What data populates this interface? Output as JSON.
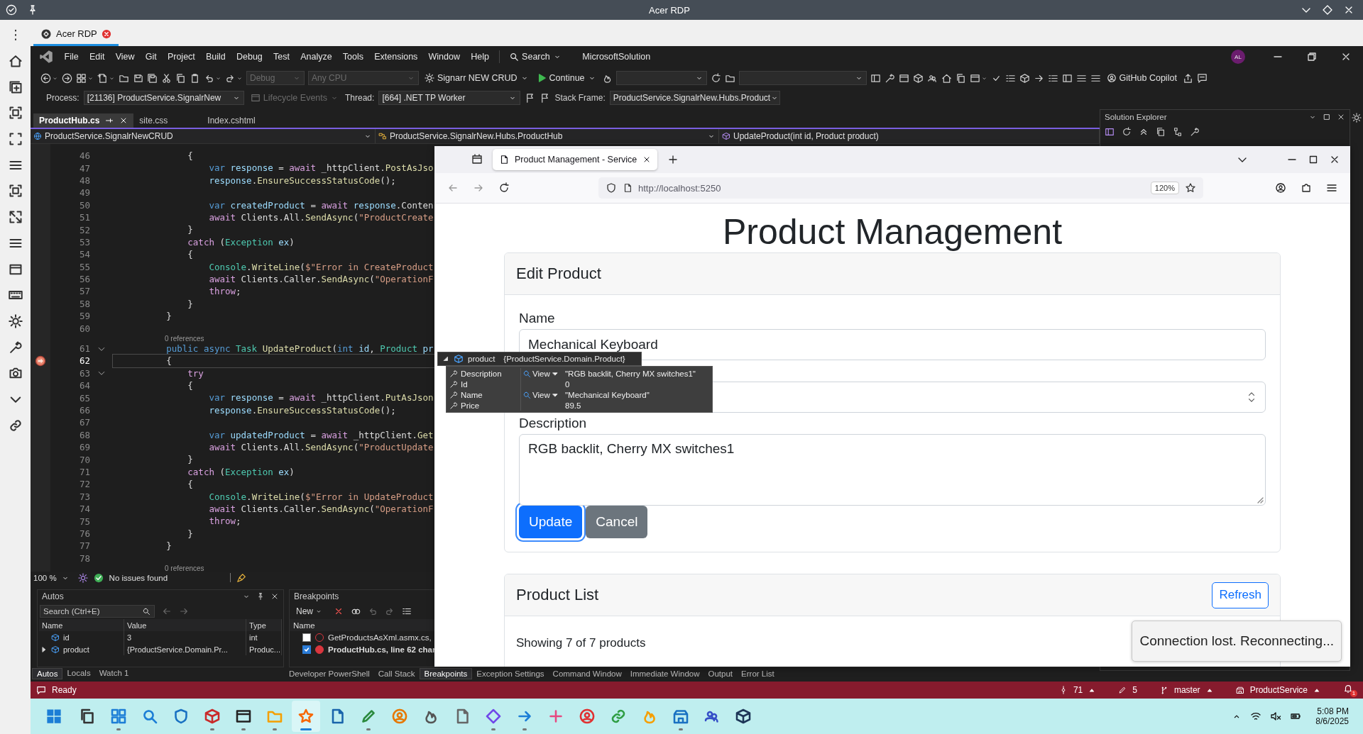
{
  "rdp": {
    "title": "Acer RDP",
    "tab": {
      "label": "Acer RDP"
    }
  },
  "vs": {
    "menu": [
      "File",
      "Edit",
      "View",
      "Git",
      "Project",
      "Build",
      "Debug",
      "Test",
      "Analyze",
      "Tools",
      "Extensions",
      "Window",
      "Help"
    ],
    "search": "Search",
    "solution": "MicrosoftSolution",
    "avatar": "AL",
    "toolbar": {
      "config": "Debug",
      "platform": "Any CPU",
      "startup": "Signarr NEW CRUD",
      "continue": "Continue",
      "copilot": "GitHub Copilot"
    },
    "debug_bar": {
      "process_label": "Process:",
      "process": "[21136] ProductService.SignalrNew",
      "lifecycle": "Lifecycle Events",
      "thread_label": "Thread:",
      "thread": "[664] .NET TP Worker",
      "frame_label": "Stack Frame:",
      "frame": "ProductService.SignalrNew.Hubs.Product"
    },
    "doc_tabs": [
      {
        "label": "ProductHub.cs",
        "selected": true,
        "pinned": true
      },
      {
        "label": "site.css",
        "selected": false,
        "pinned": false
      },
      {
        "label": "Index.cshtml",
        "selected": false,
        "pinned": false
      }
    ],
    "nav": [
      "ProductService.SignalrNewCRUD",
      "ProductService.SignalrNew.Hubs.ProductHub",
      "UpdateProduct(int id, Product product)"
    ],
    "editor": {
      "lines": [
        {
          "kind": "code",
          "num": "46",
          "fold": false,
          "current": false,
          "tokens": [
            {
              "text": "            {",
              "kind": "p"
            }
          ]
        },
        {
          "kind": "code",
          "num": "47",
          "fold": false,
          "current": false,
          "tokens": [
            {
              "text": "                var",
              "kind": "kw"
            },
            {
              "text": " response",
              "kind": "v"
            },
            {
              "text": " = ",
              "kind": "p"
            },
            {
              "text": "await",
              "kind": "ctl"
            },
            {
              "text": " _httpClient.",
              "kind": "p"
            },
            {
              "text": "PostAsJso",
              "kind": "m"
            }
          ]
        },
        {
          "kind": "code",
          "num": "48",
          "fold": false,
          "current": false,
          "tokens": [
            {
              "text": "                response",
              "kind": "v"
            },
            {
              "text": ".",
              "kind": "p"
            },
            {
              "text": "EnsureSuccessStatusCode",
              "kind": "m"
            },
            {
              "text": "();",
              "kind": "p"
            }
          ]
        },
        {
          "kind": "code",
          "num": "49",
          "fold": false,
          "current": false
        },
        {
          "kind": "code",
          "num": "50",
          "fold": false,
          "current": false,
          "tokens": [
            {
              "text": "                var",
              "kind": "kw"
            },
            {
              "text": " createdProduct",
              "kind": "v"
            },
            {
              "text": " = ",
              "kind": "p"
            },
            {
              "text": "await",
              "kind": "ctl"
            },
            {
              "text": " response",
              "kind": "v"
            },
            {
              "text": ".Conten",
              "kind": "p"
            }
          ]
        },
        {
          "kind": "code",
          "num": "51",
          "fold": false,
          "current": false,
          "tokens": [
            {
              "text": "                await",
              "kind": "ctl"
            },
            {
              "text": " Clients.All.",
              "kind": "p"
            },
            {
              "text": "SendAsync",
              "kind": "m"
            },
            {
              "text": "(",
              "kind": "p"
            },
            {
              "text": "\"ProductCreate",
              "kind": "s"
            }
          ]
        },
        {
          "kind": "code",
          "num": "52",
          "fold": false,
          "current": false,
          "tokens": [
            {
              "text": "            }",
              "kind": "p"
            }
          ]
        },
        {
          "kind": "code",
          "num": "53",
          "fold": false,
          "current": false,
          "tokens": [
            {
              "text": "            catch",
              "kind": "ctl"
            },
            {
              "text": " (",
              "kind": "p"
            },
            {
              "text": "Exception",
              "kind": "t"
            },
            {
              "text": " ex",
              "kind": "v"
            },
            {
              "text": ")",
              "kind": "p"
            }
          ]
        },
        {
          "kind": "code",
          "num": "54",
          "fold": false,
          "current": false,
          "tokens": [
            {
              "text": "            {",
              "kind": "p"
            }
          ]
        },
        {
          "kind": "code",
          "num": "55",
          "fold": false,
          "current": false,
          "tokens": [
            {
              "text": "                Console",
              "kind": "t"
            },
            {
              "text": ".",
              "kind": "p"
            },
            {
              "text": "WriteLine",
              "kind": "m"
            },
            {
              "text": "(",
              "kind": "p"
            },
            {
              "text": "$\"Error in CreateProduct",
              "kind": "s"
            }
          ]
        },
        {
          "kind": "code",
          "num": "56",
          "fold": false,
          "current": false,
          "tokens": [
            {
              "text": "                await",
              "kind": "ctl"
            },
            {
              "text": " Clients.Caller.",
              "kind": "p"
            },
            {
              "text": "SendAsync",
              "kind": "m"
            },
            {
              "text": "(",
              "kind": "p"
            },
            {
              "text": "\"OperationF",
              "kind": "s"
            }
          ]
        },
        {
          "kind": "code",
          "num": "57",
          "fold": false,
          "current": false,
          "tokens": [
            {
              "text": "                throw",
              "kind": "ctl"
            },
            {
              "text": ";",
              "kind": "p"
            }
          ]
        },
        {
          "kind": "code",
          "num": "58",
          "fold": false,
          "current": false,
          "tokens": [
            {
              "text": "            }",
              "kind": "p"
            }
          ]
        },
        {
          "kind": "code",
          "num": "59",
          "fold": false,
          "current": false,
          "tokens": [
            {
              "text": "        }",
              "kind": "p"
            }
          ]
        },
        {
          "kind": "code",
          "num": "60",
          "fold": false,
          "current": false
        },
        {
          "kind": "lens",
          "text": "0 references"
        },
        {
          "kind": "code",
          "num": "61",
          "fold": true,
          "current": false,
          "tokens": [
            {
              "text": "        public",
              "kind": "kw"
            },
            {
              "text": " async",
              "kind": "kw"
            },
            {
              "text": " Task",
              "kind": "t"
            },
            {
              "text": " UpdateProduct",
              "kind": "m"
            },
            {
              "text": "(",
              "kind": "p"
            },
            {
              "text": "int",
              "kind": "kw"
            },
            {
              "text": " id",
              "kind": "v"
            },
            {
              "text": ", ",
              "kind": "p"
            },
            {
              "text": "Product",
              "kind": "t"
            },
            {
              "text": " pr",
              "kind": "v"
            }
          ]
        },
        {
          "kind": "code",
          "num": "62",
          "fold": false,
          "current": true,
          "tokens": [
            {
              "text": "        {",
              "kind": "p"
            }
          ]
        },
        {
          "kind": "code",
          "num": "63",
          "fold": true,
          "current": false,
          "tokens": [
            {
              "text": "            try",
              "kind": "ctl"
            }
          ]
        },
        {
          "kind": "code",
          "num": "64",
          "fold": false,
          "current": false,
          "tokens": [
            {
              "text": "            {",
              "kind": "p"
            }
          ]
        },
        {
          "kind": "code",
          "num": "65",
          "fold": false,
          "current": false,
          "tokens": [
            {
              "text": "                var",
              "kind": "kw"
            },
            {
              "text": " response",
              "kind": "v"
            },
            {
              "text": " = ",
              "kind": "p"
            },
            {
              "text": "await",
              "kind": "ctl"
            },
            {
              "text": " _httpClient.",
              "kind": "p"
            },
            {
              "text": "PutAsJson",
              "kind": "m"
            }
          ]
        },
        {
          "kind": "code",
          "num": "66",
          "fold": false,
          "current": false,
          "tokens": [
            {
              "text": "                response",
              "kind": "v"
            },
            {
              "text": ".",
              "kind": "p"
            },
            {
              "text": "EnsureSuccessStatusCode",
              "kind": "m"
            },
            {
              "text": "();",
              "kind": "p"
            }
          ]
        },
        {
          "kind": "code",
          "num": "67",
          "fold": false,
          "current": false
        },
        {
          "kind": "code",
          "num": "68",
          "fold": false,
          "current": false,
          "tokens": [
            {
              "text": "                var",
              "kind": "kw"
            },
            {
              "text": " updatedProduct",
              "kind": "v"
            },
            {
              "text": " = ",
              "kind": "p"
            },
            {
              "text": "await",
              "kind": "ctl"
            },
            {
              "text": " _httpClient.",
              "kind": "p"
            },
            {
              "text": "Get",
              "kind": "m"
            }
          ]
        },
        {
          "kind": "code",
          "num": "69",
          "fold": false,
          "current": false,
          "tokens": [
            {
              "text": "                await",
              "kind": "ctl"
            },
            {
              "text": " Clients.All.",
              "kind": "p"
            },
            {
              "text": "SendAsync",
              "kind": "m"
            },
            {
              "text": "(",
              "kind": "p"
            },
            {
              "text": "\"ProductUpdate",
              "kind": "s"
            }
          ]
        },
        {
          "kind": "code",
          "num": "70",
          "fold": false,
          "current": false,
          "tokens": [
            {
              "text": "            }",
              "kind": "p"
            }
          ]
        },
        {
          "kind": "code",
          "num": "71",
          "fold": false,
          "current": false,
          "tokens": [
            {
              "text": "            catch",
              "kind": "ctl"
            },
            {
              "text": " (",
              "kind": "p"
            },
            {
              "text": "Exception",
              "kind": "t"
            },
            {
              "text": " ex",
              "kind": "v"
            },
            {
              "text": ")",
              "kind": "p"
            }
          ]
        },
        {
          "kind": "code",
          "num": "72",
          "fold": false,
          "current": false,
          "tokens": [
            {
              "text": "            {",
              "kind": "p"
            }
          ]
        },
        {
          "kind": "code",
          "num": "73",
          "fold": false,
          "current": false,
          "tokens": [
            {
              "text": "                Console",
              "kind": "t"
            },
            {
              "text": ".",
              "kind": "p"
            },
            {
              "text": "WriteLine",
              "kind": "m"
            },
            {
              "text": "(",
              "kind": "p"
            },
            {
              "text": "$\"Error in UpdateProduct",
              "kind": "s"
            }
          ]
        },
        {
          "kind": "code",
          "num": "74",
          "fold": false,
          "current": false,
          "tokens": [
            {
              "text": "                await",
              "kind": "ctl"
            },
            {
              "text": " Clients.Caller.",
              "kind": "p"
            },
            {
              "text": "SendAsync",
              "kind": "m"
            },
            {
              "text": "(",
              "kind": "p"
            },
            {
              "text": "\"OperationF",
              "kind": "s"
            }
          ]
        },
        {
          "kind": "code",
          "num": "75",
          "fold": false,
          "current": false,
          "tokens": [
            {
              "text": "                throw",
              "kind": "ctl"
            },
            {
              "text": ";",
              "kind": "p"
            }
          ]
        },
        {
          "kind": "code",
          "num": "76",
          "fold": false,
          "current": false,
          "tokens": [
            {
              "text": "            }",
              "kind": "p"
            }
          ]
        },
        {
          "kind": "code",
          "num": "77",
          "fold": false,
          "current": false,
          "tokens": [
            {
              "text": "        }",
              "kind": "p"
            }
          ]
        },
        {
          "kind": "code",
          "num": "78",
          "fold": false,
          "current": false
        },
        {
          "kind": "lens",
          "text": "0 references"
        }
      ],
      "zoom": "100 %",
      "issues": "No issues found"
    },
    "datatip": {
      "title": "product",
      "type": "{ProductService.Domain.Product}",
      "expanded": true,
      "rows": [
        {
          "name": "Description",
          "view": "View",
          "value": "\"RGB backlit, Cherry MX switches1\""
        },
        {
          "name": "Id",
          "value": "0"
        },
        {
          "name": "Name",
          "view": "View",
          "value": "\"Mechanical Keyboard\""
        },
        {
          "name": "Price",
          "value": "89.5"
        }
      ]
    },
    "autos": {
      "title": "Autos",
      "search_placeholder": "Search (Ctrl+E)",
      "columns": [
        "Name",
        "Value",
        "Type"
      ],
      "rows": [
        {
          "name": "id",
          "value": "3",
          "type": "int",
          "expandable": false
        },
        {
          "name": "product",
          "value": "{ProductService.Domain.Pr...",
          "type": "Produc...",
          "expandable": true
        }
      ],
      "tabs": [
        {
          "label": "Autos",
          "selected": true
        },
        {
          "label": "Locals",
          "selected": false
        },
        {
          "label": "Watch 1",
          "selected": false
        }
      ]
    },
    "breakpoints": {
      "title": "Breakpoints",
      "new": "New",
      "column": "Name",
      "rows": [
        {
          "label": "GetProductsAsXml.asmx.cs,",
          "enabled": false
        },
        {
          "label": "ProductHub.cs, line 62 char",
          "enabled": true
        }
      ]
    },
    "bottom_tabs": [
      {
        "label": "Developer PowerShell",
        "selected": false
      },
      {
        "label": "Call Stack",
        "selected": false
      },
      {
        "label": "Breakpoints",
        "selected": true
      },
      {
        "label": "Exception Settings",
        "selected": false
      },
      {
        "label": "Command Window",
        "selected": false
      },
      {
        "label": "Immediate Window",
        "selected": false
      },
      {
        "label": "Output",
        "selected": false
      },
      {
        "label": "Error List",
        "selected": false
      }
    ],
    "solution_explorer": {
      "title": "Solution Explorer"
    },
    "status": {
      "text": "Ready",
      "commits": "71",
      "changes": "5",
      "branch": "master",
      "repo": "ProductService",
      "notifications": "1"
    }
  },
  "browser": {
    "tab": {
      "title": "Product Management - Service"
    },
    "url": "http://localhost:5250",
    "zoom": "120%",
    "page": {
      "heading": "Product Management",
      "edit": {
        "title": "Edit Product",
        "fields": [
          {
            "kind": "text",
            "label": "Name",
            "value": "Mechanical Keyboard"
          },
          {
            "kind": "number"
          },
          {
            "kind": "textarea",
            "label": "Description",
            "value": "RGB backlit, Cherry MX switches1"
          }
        ],
        "buttons": [
          {
            "label": "Update",
            "kind": "primary",
            "focused": true
          },
          {
            "label": "Cancel",
            "kind": "secondary",
            "focused": false
          }
        ]
      },
      "list": {
        "title": "Product List",
        "refresh": "Refresh",
        "summary": "Showing 7 of 7 products"
      },
      "toast": "Connection lost. Reconnecting..."
    }
  },
  "taskbar": {
    "apps": [
      {
        "running": false,
        "selected": false
      },
      {
        "running": true,
        "selected": false
      },
      {
        "running": false,
        "selected": false
      },
      {
        "running": false,
        "selected": false
      },
      {
        "running": true,
        "selected": false
      },
      {
        "running": true,
        "selected": false
      },
      {
        "running": true,
        "selected": false
      },
      {
        "running": true,
        "selected": true
      },
      {
        "running": false,
        "selected": false
      },
      {
        "running": true,
        "selected": false
      },
      {
        "running": false,
        "selected": false
      },
      {
        "running": false,
        "selected": false
      },
      {
        "running": false,
        "selected": false
      },
      {
        "running": true,
        "selected": false
      },
      {
        "running": true,
        "selected": false
      },
      {
        "running": false,
        "selected": false
      },
      {
        "running": false,
        "selected": false
      },
      {
        "running": false,
        "selected": false
      },
      {
        "running": false,
        "selected": false
      },
      {
        "running": true,
        "selected": false
      },
      {
        "running": false,
        "selected": false
      },
      {
        "running": false,
        "selected": false
      }
    ],
    "time": "5:08 PM",
    "date": "8/6/2025"
  }
}
